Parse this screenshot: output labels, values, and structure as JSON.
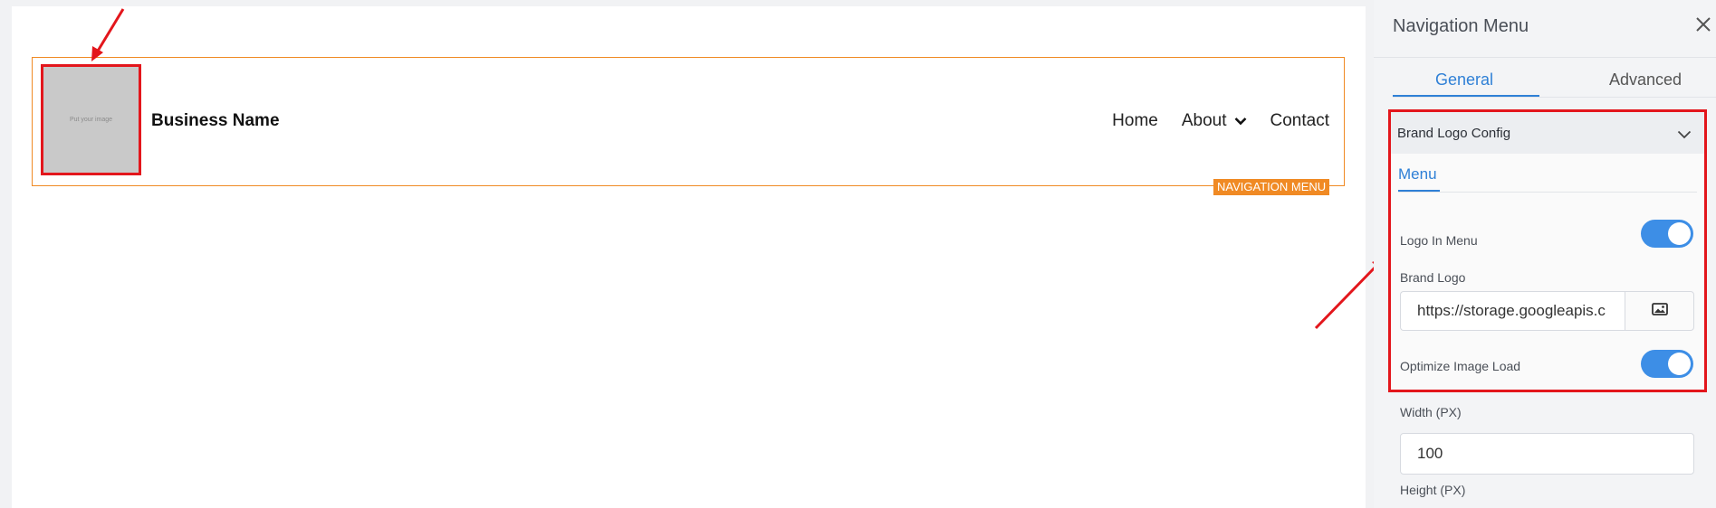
{
  "canvas": {
    "logo_placeholder": "Put your image",
    "business_name": "Business Name",
    "menu": [
      "Home",
      "About",
      "Contact"
    ],
    "component_tag": "NAVIGATION MENU"
  },
  "panel": {
    "title": "Navigation Menu",
    "tabs": [
      "General",
      "Advanced"
    ],
    "active_tab": "General",
    "section": {
      "title": "Brand Logo Config",
      "subtab": "Menu",
      "logo_in_menu_label": "Logo In Menu",
      "logo_in_menu": true,
      "brand_logo_label": "Brand Logo",
      "brand_logo_value": "https://storage.googleapis.c",
      "optimize_label": "Optimize Image Load",
      "optimize": true
    },
    "width_label": "Width (PX)",
    "width_value": "100",
    "height_label": "Height (PX)"
  },
  "colors": {
    "accent": "#2f80d6",
    "toggle_on": "#3d8ee6",
    "highlight": "#e3161c",
    "component_outline": "#f08a24"
  },
  "icons": [
    "chevron-down-icon",
    "close-icon",
    "image-icon",
    "annotation-arrow"
  ]
}
